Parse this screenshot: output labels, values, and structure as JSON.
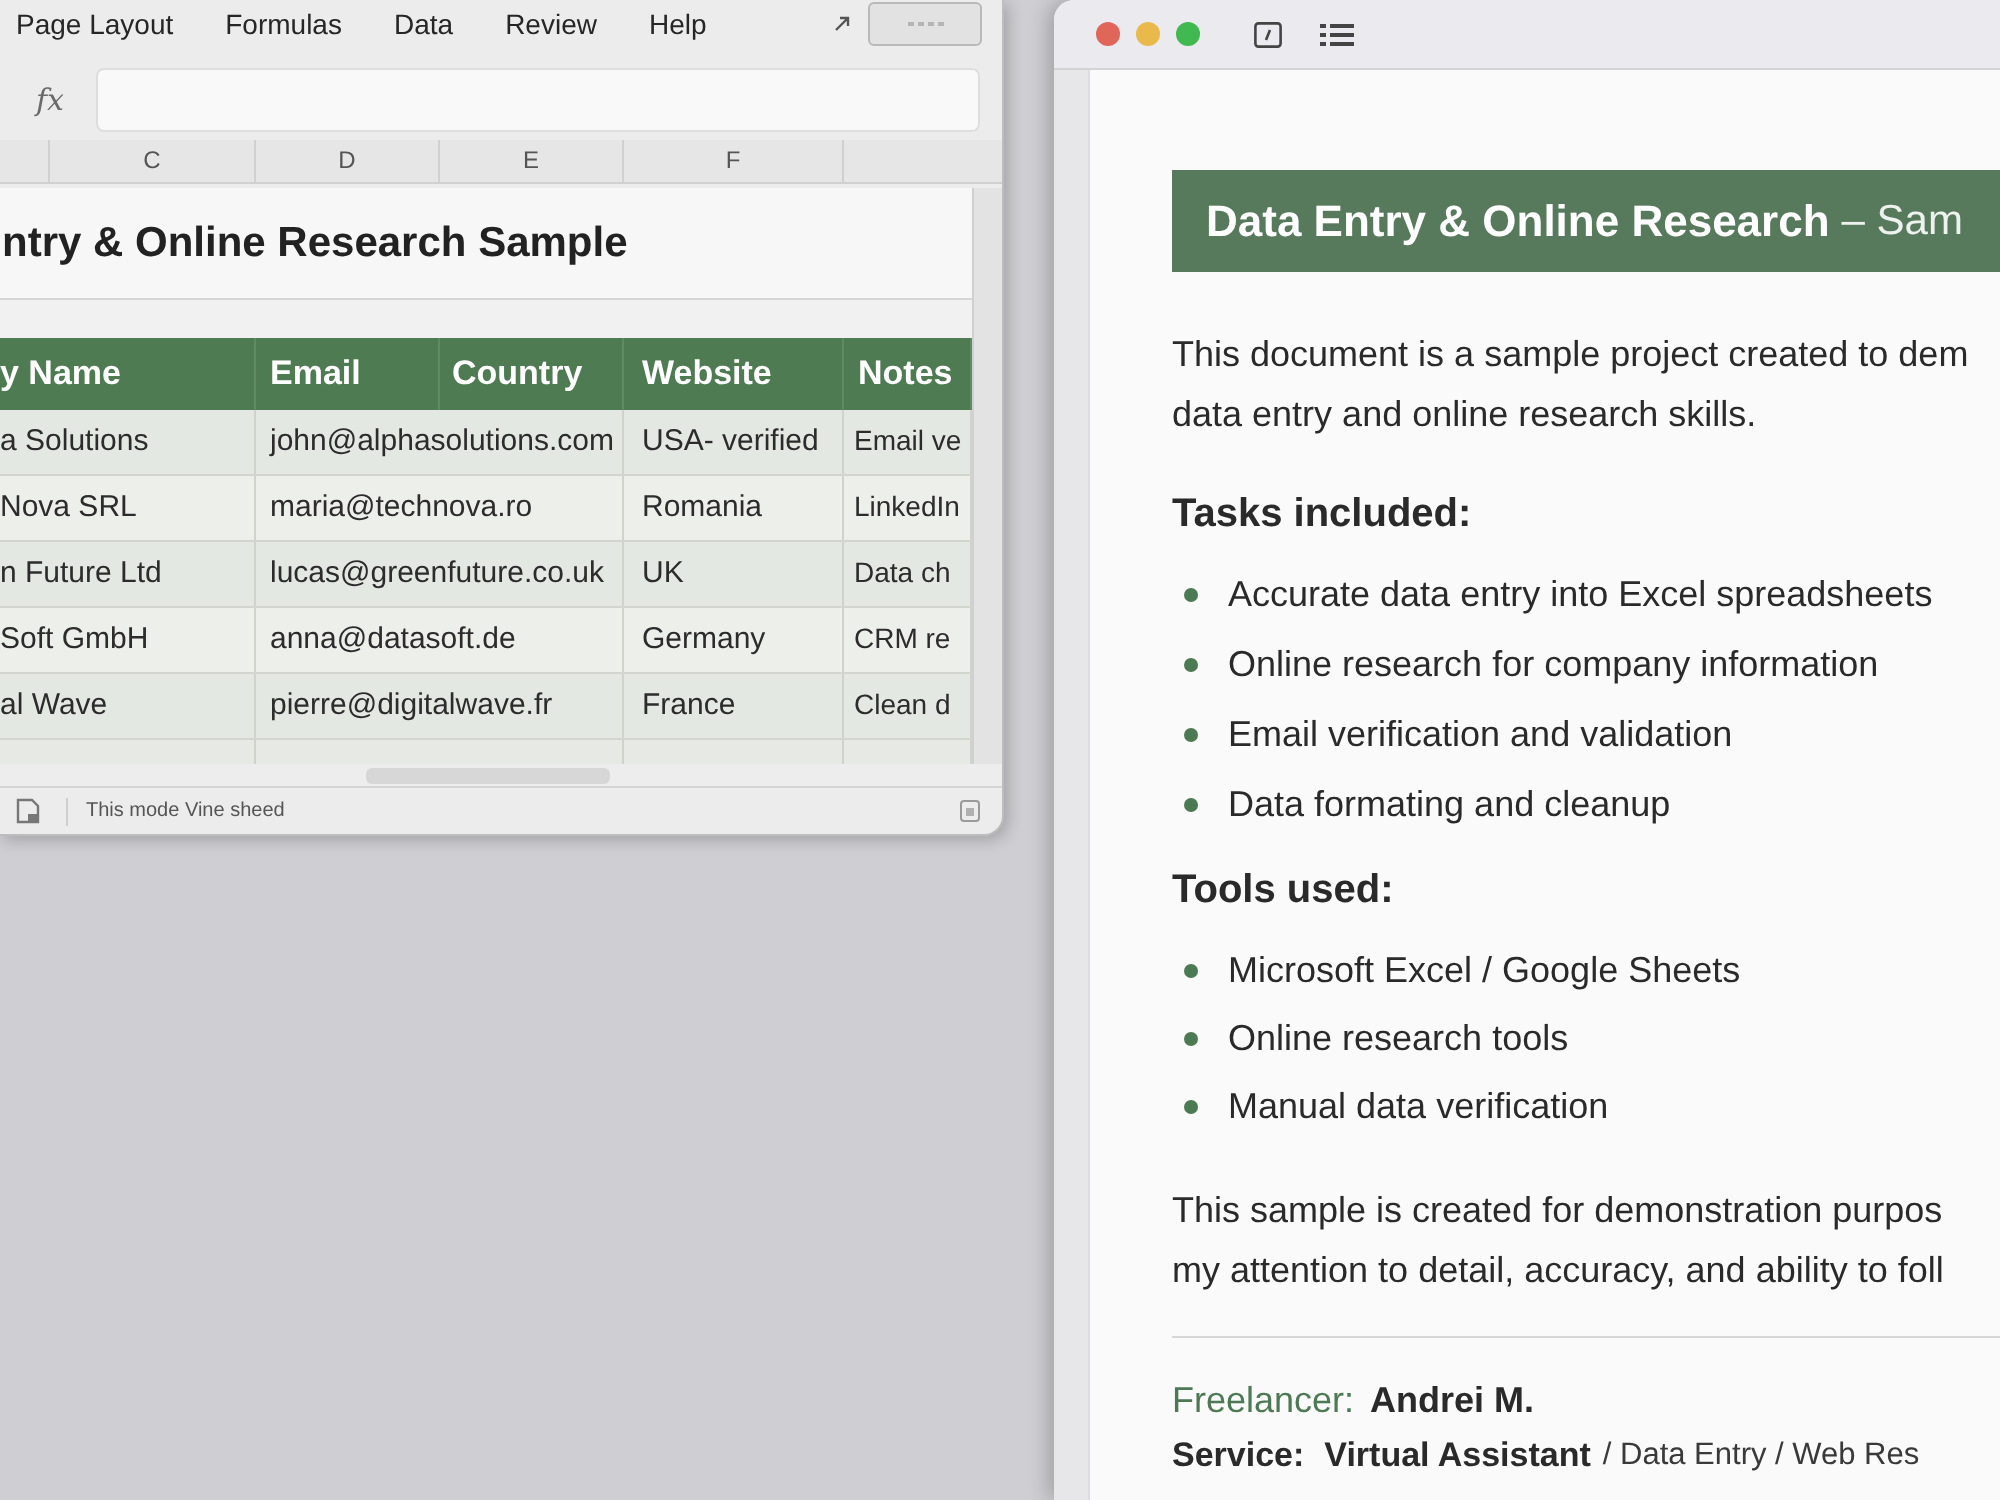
{
  "spreadsheet": {
    "ribbon_tabs": [
      "Page Layout",
      "Formulas",
      "Data",
      "Review",
      "Help"
    ],
    "formula_bar": {
      "function_label": "fx"
    },
    "column_headers": [
      "C",
      "D",
      "E",
      "F"
    ],
    "sheet_title": "ntry & Online Research Sample",
    "table": {
      "columns": [
        "y Name",
        "Email",
        "Country",
        "Website",
        "Notes"
      ],
      "rows": [
        [
          "a Solutions",
          "john@alphasolutions.com",
          "",
          "USA- verified",
          "Email ve"
        ],
        [
          "Nova SRL",
          "maria@technova.ro",
          "",
          "Romania",
          "LinkedIn"
        ],
        [
          "n Future Ltd",
          "lucas@greenfuture.co.uk",
          "",
          "UK",
          "Data ch"
        ],
        [
          "Soft GmbH",
          "anna@datasoft.de",
          "",
          "Germany",
          "CRM re"
        ],
        [
          "al Wave",
          "pierre@digitalwave.fr",
          "",
          "France",
          "Clean d"
        ]
      ]
    },
    "status_bar": {
      "text": "This mode Vine sheed"
    }
  },
  "document_window": {
    "heading": {
      "title": "Data Entry & Online Research",
      "subtitle": "– Sam"
    },
    "intro": [
      "This document is a sample project created to dem",
      "data entry and online research skills."
    ],
    "sections": [
      {
        "heading": "Tasks included:",
        "items": [
          "Accurate data entry into Excel spreadsheets",
          "Online research for company information",
          "Email verification and validation",
          "Data formating and cleanup"
        ]
      },
      {
        "heading": "Tools used:",
        "items": [
          "Microsoft Excel / Google Sheets",
          "Online research tools",
          "Manual data verification"
        ]
      }
    ],
    "closing": [
      "This sample is created for demonstration purpos",
      "my attention to detail, accuracy, and ability to foll"
    ],
    "credits": {
      "freelancer_label": "Freelancer:",
      "freelancer_name": "Andrei M.",
      "service_label": "Service:",
      "service_name": "Virtual Assistant",
      "service_details": "/ Data Entry / Web Res"
    }
  }
}
